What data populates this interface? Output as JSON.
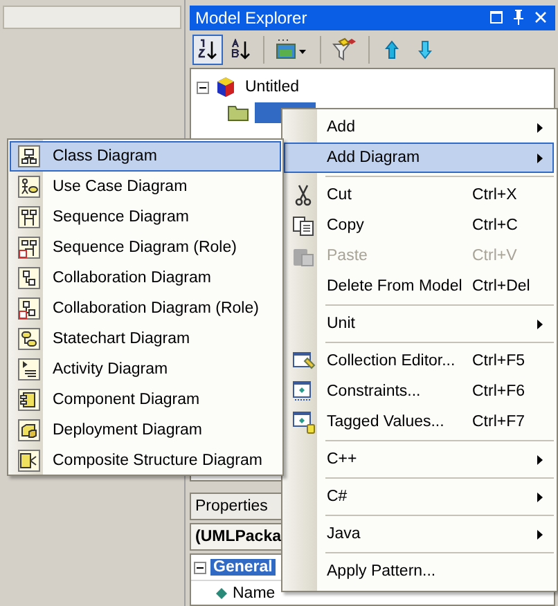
{
  "model_explorer": {
    "title": "Model Explorer",
    "toolbar": [
      {
        "kind": "sort-numeric",
        "selected": true
      },
      {
        "kind": "sort-alpha",
        "selected": false
      },
      {
        "kind": "separator"
      },
      {
        "kind": "image-dropdown",
        "selected": false
      },
      {
        "kind": "separator"
      },
      {
        "kind": "filter",
        "selected": false
      },
      {
        "kind": "separator"
      },
      {
        "kind": "up",
        "selected": false
      },
      {
        "kind": "down",
        "selected": false
      }
    ],
    "tree": [
      {
        "label": "Untitled",
        "expanded": true,
        "selected": false,
        "children": [
          {
            "selected": true
          }
        ]
      }
    ]
  },
  "properties": {
    "title": "Properties",
    "object": "(UMLPacka",
    "categories": [
      {
        "label": "General",
        "expanded": true,
        "selected": true,
        "rows": [
          {
            "name": "Name"
          }
        ]
      }
    ]
  },
  "context_menu": {
    "items": [
      {
        "kind": "submenu",
        "label": "Add",
        "selected": false,
        "disabled": false
      },
      {
        "kind": "submenu",
        "label": "Add Diagram",
        "selected": true,
        "disabled": false
      },
      {
        "kind": "separator"
      },
      {
        "kind": "command",
        "label": "Cut",
        "shortcut": "Ctrl+X",
        "selected": false,
        "disabled": false
      },
      {
        "kind": "command",
        "label": "Copy",
        "shortcut": "Ctrl+C",
        "selected": false,
        "disabled": false
      },
      {
        "kind": "command",
        "label": "Paste",
        "shortcut": "Ctrl+V",
        "selected": false,
        "disabled": true
      },
      {
        "kind": "command",
        "label": "Delete From Model",
        "shortcut": "Ctrl+Del",
        "selected": false,
        "disabled": false
      },
      {
        "kind": "separator"
      },
      {
        "kind": "submenu",
        "label": "Unit",
        "selected": false,
        "disabled": false
      },
      {
        "kind": "separator"
      },
      {
        "kind": "command",
        "label": "Collection Editor...",
        "shortcut": "Ctrl+F5",
        "selected": false,
        "disabled": false
      },
      {
        "kind": "command",
        "label": "Constraints...",
        "shortcut": "Ctrl+F6",
        "selected": false,
        "disabled": false
      },
      {
        "kind": "command",
        "label": "Tagged Values...",
        "shortcut": "Ctrl+F7",
        "selected": false,
        "disabled": false
      },
      {
        "kind": "separator"
      },
      {
        "kind": "submenu",
        "label": "C++",
        "selected": false,
        "disabled": false
      },
      {
        "kind": "separator"
      },
      {
        "kind": "submenu",
        "label": "C#",
        "selected": false,
        "disabled": false
      },
      {
        "kind": "separator"
      },
      {
        "kind": "submenu",
        "label": "Java",
        "selected": false,
        "disabled": false
      },
      {
        "kind": "separator"
      },
      {
        "kind": "command",
        "label": "Apply Pattern...",
        "selected": false,
        "disabled": false
      }
    ]
  },
  "diagram_submenu": {
    "items": [
      {
        "label": "Class Diagram",
        "selected": true
      },
      {
        "label": "Use Case Diagram",
        "selected": false
      },
      {
        "label": "Sequence Diagram",
        "selected": false
      },
      {
        "label": "Sequence Diagram (Role)",
        "selected": false
      },
      {
        "label": "Collaboration Diagram",
        "selected": false
      },
      {
        "label": "Collaboration Diagram (Role)",
        "selected": false
      },
      {
        "label": "Statechart Diagram",
        "selected": false
      },
      {
        "label": "Activity Diagram",
        "selected": false
      },
      {
        "label": "Component Diagram",
        "selected": false
      },
      {
        "label": "Deployment Diagram",
        "selected": false
      },
      {
        "label": "Composite Structure Diagram",
        "selected": false
      }
    ]
  }
}
